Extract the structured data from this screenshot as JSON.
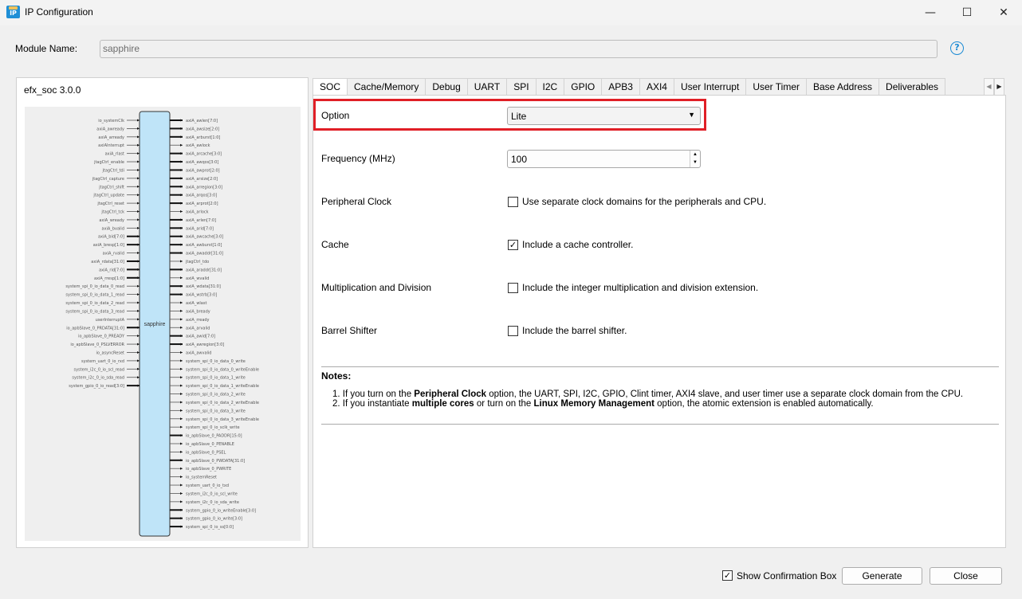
{
  "window": {
    "title": "IP Configuration",
    "app_icon_text": "IP",
    "minimize": "—",
    "maximize": "☐",
    "close": "✕"
  },
  "module": {
    "label": "Module Name:",
    "value": "sapphire",
    "help": "?"
  },
  "left_panel": {
    "title": "efx_soc 3.0.0",
    "block_name": "sapphire",
    "inputs": [
      "io_systemClk",
      "axiA_awready",
      "axiA_arready",
      "axiAInterrupt",
      "axiA_rlast",
      "jtagCtrl_enable",
      "jtagCtrl_tdi",
      "jtagCtrl_capture",
      "jtagCtrl_shift",
      "jtagCtrl_update",
      "jtagCtrl_reset",
      "jtagCtrl_tck",
      "axiA_wready",
      "axiA_bvalid",
      "axiA_bid[7:0]",
      "axiA_bresp[1:0]",
      "axiA_rvalid",
      "axiA_rdata[31:0]",
      "axiA_rid[7:0]",
      "axiA_rresp[1:0]",
      "system_spi_0_io_data_0_read",
      "system_spi_0_io_data_1_read",
      "system_spi_0_io_data_2_read",
      "system_spi_0_io_data_3_read",
      "userInterruptA",
      "io_apbSlave_0_PRDATA[31:0]",
      "io_apbSlave_0_PREADY",
      "io_apbSlave_0_PSLVERROR",
      "io_asyncReset",
      "system_uart_0_io_rxd",
      "system_i2c_0_io_scl_read",
      "system_i2c_0_io_sda_read",
      "system_gpio_0_io_read[3:0]"
    ],
    "outputs": [
      "axiA_awlen[7:0]",
      "axiA_awsize[2:0]",
      "axiA_arburst[1:0]",
      "axiA_awlock",
      "axiA_arcache[3:0]",
      "axiA_awqos[3:0]",
      "axiA_awprot[2:0]",
      "axiA_arsize[2:0]",
      "axiA_arregion[3:0]",
      "axiA_arqos[3:0]",
      "axiA_arprot[2:0]",
      "axiA_arlock",
      "axiA_arlen[7:0]",
      "axiA_arid[7:0]",
      "axiA_awcache[3:0]",
      "axiA_awburst[1:0]",
      "axiA_awaddr[31:0]",
      "jtagCtrl_tdo",
      "axiA_araddr[31:0]",
      "axiA_wvalid",
      "axiA_wdata[31:0]",
      "axiA_wstrb[3:0]",
      "axiA_wlast",
      "axiA_bready",
      "axiA_rready",
      "axiA_arvalid",
      "axiA_awid[7:0]",
      "axiA_awregion[3:0]",
      "axiA_awvalid",
      "system_spi_0_io_data_0_write",
      "system_spi_0_io_data_0_writeEnable",
      "system_spi_0_io_data_1_write",
      "system_spi_0_io_data_1_writeEnable",
      "system_spi_0_io_data_2_write",
      "system_spi_0_io_data_2_writeEnable",
      "system_spi_0_io_data_3_write",
      "system_spi_0_io_data_3_writeEnable",
      "system_spi_0_io_sclk_write",
      "io_apbSlave_0_PADDR[15:0]",
      "io_apbSlave_0_PENABLE",
      "io_apbSlave_0_PSEL",
      "io_apbSlave_0_PWDATA[31:0]",
      "io_apbSlave_0_PWRITE",
      "io_systemReset",
      "system_uart_0_io_txd",
      "system_i2c_0_io_scl_write",
      "system_i2c_0_io_sda_write",
      "system_gpio_0_io_writeEnable[3:0]",
      "system_gpio_0_io_write[3:0]",
      "system_spi_0_io_ss[0:0]"
    ]
  },
  "tabs": [
    "SOC",
    "Cache/Memory",
    "Debug",
    "UART",
    "SPI",
    "I2C",
    "GPIO",
    "APB3",
    "AXI4",
    "User Interrupt",
    "User Timer",
    "Base Address",
    "Deliverables"
  ],
  "selected_tab": "SOC",
  "soc": {
    "option": {
      "label": "Option",
      "value": "Lite"
    },
    "frequency": {
      "label": "Frequency (MHz)",
      "value": "100"
    },
    "peripheral_clock": {
      "label": "Peripheral Clock",
      "text": "Use separate clock domains for the peripherals and CPU.",
      "checked": false
    },
    "cache": {
      "label": "Cache",
      "text": "Include a cache controller.",
      "checked": true
    },
    "mul_div": {
      "label": "Multiplication and Division",
      "text": "Include the integer multiplication and division extension.",
      "checked": false
    },
    "barrel": {
      "label": "Barrel Shifter",
      "text": "Include the barrel shifter.",
      "checked": false
    },
    "highlight_color": "#e01f26"
  },
  "notes": {
    "title": "Notes:",
    "n1": {
      "a": "1. If you turn on the ",
      "b": "Peripheral Clock",
      "c": " option, the UART, SPI, I2C, GPIO, Clint timer, AXI4 slave, and user timer use a separate clock domain from the CPU."
    },
    "n2": {
      "a": "2. If you instantiate ",
      "b": "multiple cores",
      "c": " or turn on the ",
      "d": "Linux Memory Management",
      "e": " option, the atomic extension is enabled automatically."
    }
  },
  "footer": {
    "confirm_label": "Show Confirmation Box",
    "confirm_checked": true,
    "generate": "Generate",
    "close": "Close"
  }
}
